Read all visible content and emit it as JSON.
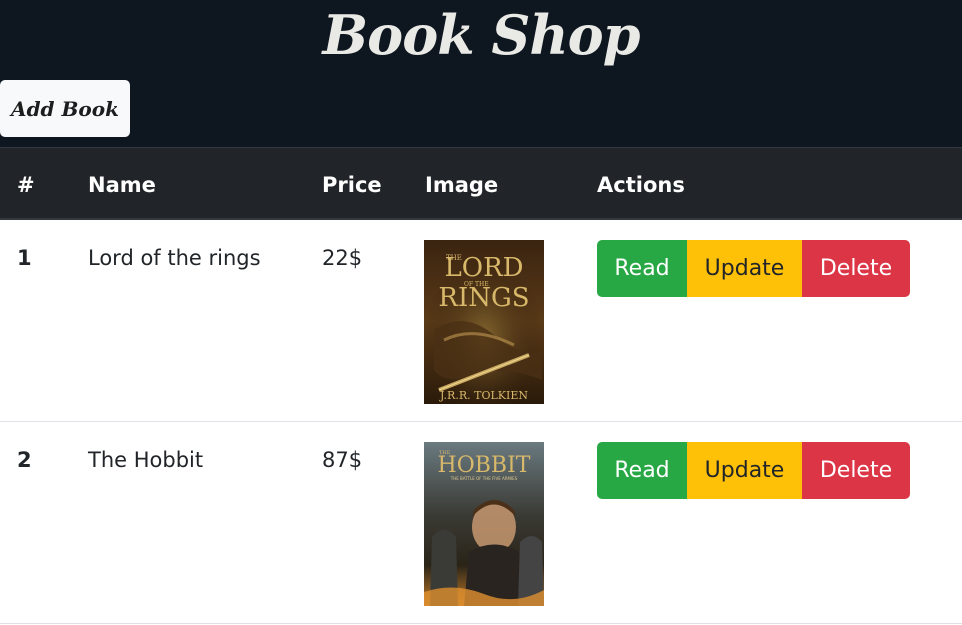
{
  "header": {
    "title": "Book Shop",
    "add_button_label": "Add Book"
  },
  "table": {
    "columns": [
      "#",
      "Name",
      "Price",
      "Image",
      "Actions"
    ],
    "rows": [
      {
        "num": "1",
        "name": "Lord of the rings",
        "price": "22$",
        "cover": {
          "line1": "THE",
          "line2": "LORD",
          "line3": "OF THE",
          "line4": "RINGS",
          "author": "J.R.R. TOLKIEN"
        }
      },
      {
        "num": "2",
        "name": "The Hobbit",
        "price": "87$",
        "cover": {
          "line1": "THE",
          "line2": "HOBBIT",
          "line3": "THE BATTLE OF THE FIVE ARMIES"
        }
      }
    ],
    "actions": {
      "read": "Read",
      "update": "Update",
      "delete": "Delete"
    }
  },
  "colors": {
    "header_bg": "#0e1720",
    "table_head_bg": "#212529",
    "read": "#28a745",
    "update": "#ffc107",
    "delete": "#dc3545"
  }
}
